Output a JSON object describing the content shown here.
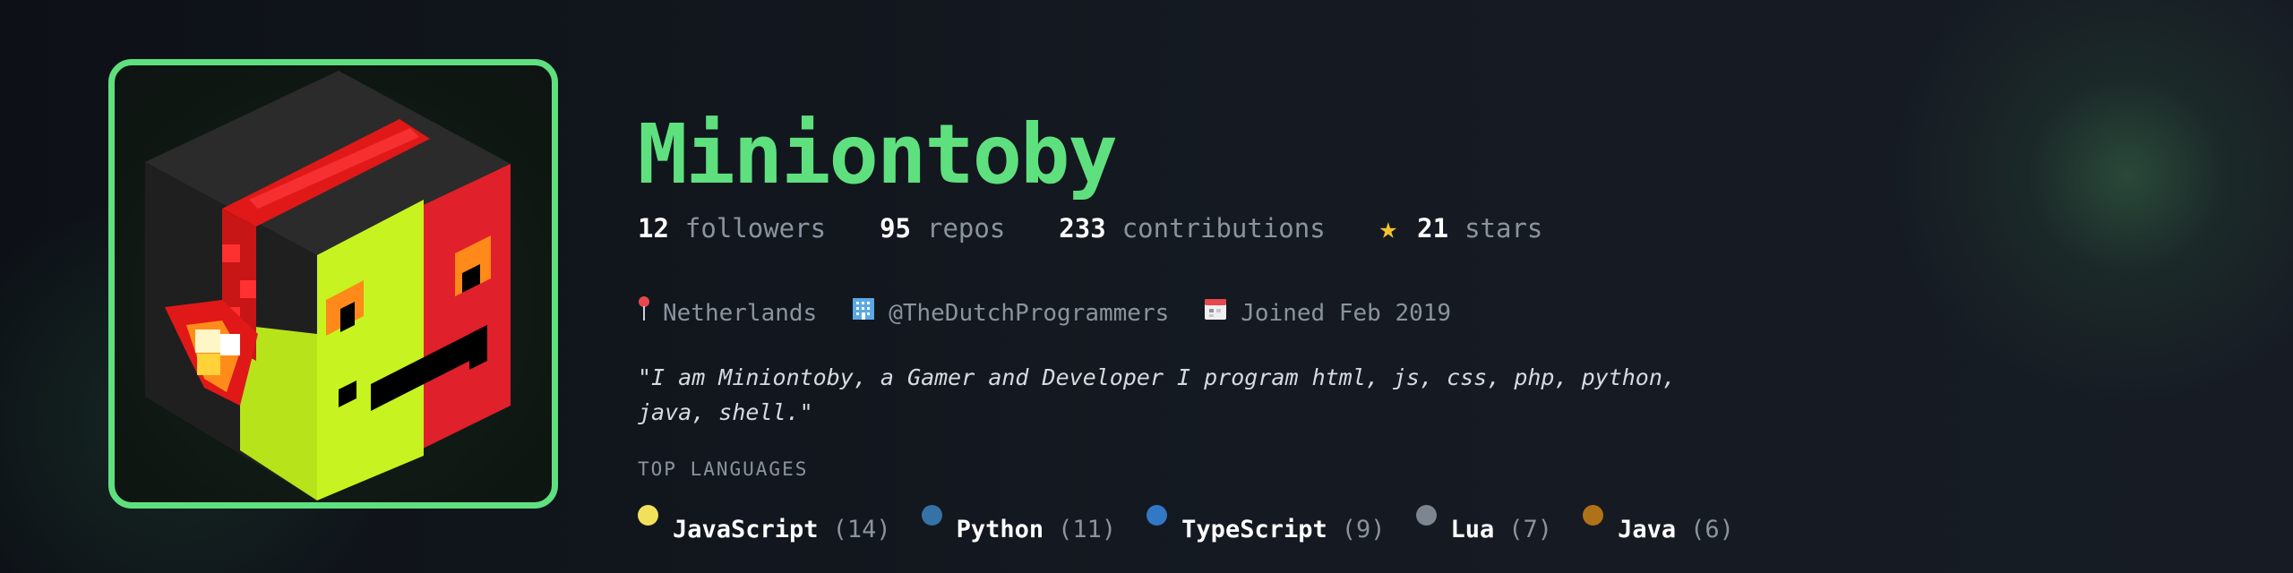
{
  "profile": {
    "name": "Miniontoby",
    "avatar_alt": "pixel-art-cube-avatar"
  },
  "stats": [
    {
      "value": "12",
      "label": "followers"
    },
    {
      "value": "95",
      "label": "repos"
    },
    {
      "value": "233",
      "label": "contributions"
    },
    {
      "value": "21",
      "label": "stars",
      "icon": "star-icon"
    }
  ],
  "meta": {
    "location": "Netherlands",
    "organization": "@TheDutchProgrammers",
    "joined": "Joined Feb 2019",
    "location_icon": "pin-icon",
    "organization_icon": "building-icon",
    "joined_icon": "calendar-icon"
  },
  "bio": "\"I am Miniontoby, a Gamer and Developer I program html, js, css, php, python, java, shell.\"",
  "languages": {
    "title": "TOP LANGUAGES",
    "items": [
      {
        "name": "JavaScript",
        "count": "(14)",
        "color": "#f1e05a"
      },
      {
        "name": "Python",
        "count": "(11)",
        "color": "#3572a5"
      },
      {
        "name": "TypeScript",
        "count": "(9)",
        "color": "#3178c6"
      },
      {
        "name": "Lua",
        "count": "(7)",
        "color": "#7d8590"
      },
      {
        "name": "Java",
        "count": "(6)",
        "color": "#b07219"
      }
    ]
  },
  "colors": {
    "accent": "#5fe07f",
    "background": "#0d1117",
    "muted": "#8b949e"
  }
}
